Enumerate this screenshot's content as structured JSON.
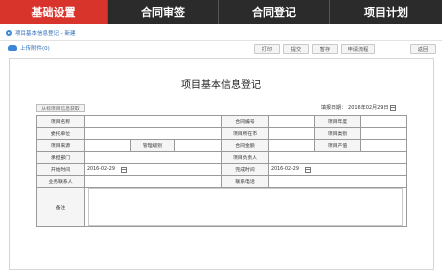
{
  "tabs": [
    {
      "label": "基础设置"
    },
    {
      "label": "合同审签"
    },
    {
      "label": "合同登记"
    },
    {
      "label": "项目计划"
    }
  ],
  "breadcrumb": "项目基本信息登记 - 新建",
  "toolbar": {
    "upload_label": "上传附件(0)",
    "print": "打印",
    "submit": "提交",
    "save_draft": "暂存",
    "apply_flow": "申请流程",
    "back": "返回"
  },
  "form": {
    "title": "项目基本信息登记",
    "tag_button": "从标项目信息获取",
    "register_date_label": "填报日期：",
    "register_date": "2016年02月29日",
    "fields": {
      "project_name": "项目名称",
      "contract_no": "合同编号",
      "project_year": "项目年度",
      "client_unit": "委托单位",
      "project_location": "项目所在市",
      "project_category": "项目类别",
      "project_source": "项目来源",
      "manage_level": "管理级别",
      "contract_amount": "合同金额",
      "project_output": "项目产值",
      "undertake_dept": "承担部门",
      "project_leader": "项目负责人",
      "start_time": "开始时间",
      "start_value": "2016-02-29",
      "end_time": "完成时间",
      "end_value": "2016-02-29",
      "business_contact": "业务联系人",
      "contact_phone": "联系电话",
      "remarks": "备注"
    }
  }
}
